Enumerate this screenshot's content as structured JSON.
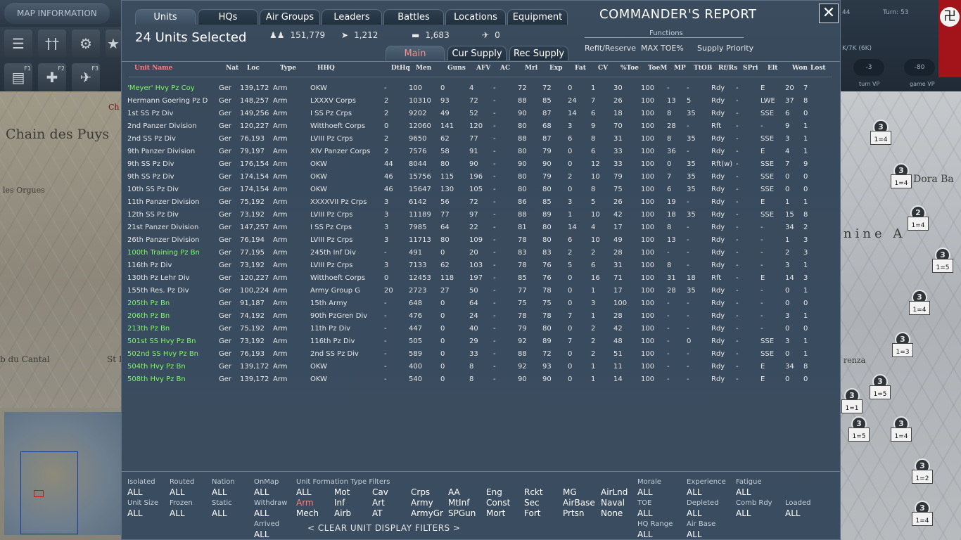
{
  "map": {
    "info_button": "MAP INFORMATION",
    "labels": [
      "Chain des Puys",
      "les Orgues",
      "b du Cantal",
      "St I",
      "Dora Ba",
      "nine A",
      "renza",
      "Ch"
    ],
    "status": {
      "left_value": "44",
      "turn": "Turn: 53",
      "supply": "K/7K (6K)",
      "pill_a": "-3",
      "pill_b": "-80",
      "turn_vp": "turn VP",
      "game_vp": "game VP"
    },
    "counters": [
      {
        "top": "3",
        "bottom": "1=4"
      },
      {
        "top": "3",
        "bottom": "1=4"
      },
      {
        "top": "2",
        "bottom": "1=4"
      },
      {
        "top": "3",
        "bottom": "1=5"
      },
      {
        "top": "3",
        "bottom": "1=4"
      },
      {
        "top": "3",
        "bottom": "1=3"
      },
      {
        "top": "3",
        "bottom": "1=5"
      },
      {
        "top": "3",
        "bottom": "1=5"
      },
      {
        "top": "3",
        "bottom": "1=4"
      },
      {
        "top": "3",
        "bottom": "1=2"
      },
      {
        "top": "3",
        "bottom": "1=4"
      },
      {
        "top": "3",
        "bottom": "1=1"
      },
      {
        "top": "3",
        "bottom": "1=5"
      }
    ],
    "toolbar_keys": [
      "F1",
      "F2",
      "F3"
    ]
  },
  "dialog": {
    "title": "COMMANDER'S REPORT",
    "tabs": [
      "Units",
      "HQs",
      "Air Groups",
      "Leaders",
      "Battles",
      "Locations",
      "Equipment"
    ],
    "active_tab": "Units",
    "units_selected": "24 Units Selected",
    "stats": {
      "men": "151,779",
      "guns": "1,212",
      "afv": "1,683",
      "aircraft": "0"
    },
    "functions": {
      "label": "Functions",
      "refit": "Refit/Reserve",
      "max_toe": "MAX TOE%",
      "supply": "Supply Priority"
    },
    "subtabs": [
      "Main",
      "Cur Supply",
      "Rec Supply"
    ],
    "active_subtab": "Main",
    "columns": [
      "Unit Name",
      "Nat",
      "Loc",
      "Type",
      "HHQ",
      "DtHq",
      "Men",
      "Guns",
      "AFV",
      "AC",
      "Mrl",
      "Exp",
      "Fat",
      "CV",
      "%Toe",
      "ToeM",
      "MP",
      "TtOB",
      "Rf/Rs",
      "SPri",
      "Elt",
      "Won",
      "Lost"
    ],
    "rows": [
      {
        "name": "'Meyer' Hvy Pz Coy",
        "green": true,
        "v": [
          "Ger",
          "139,172",
          "Arm",
          "OKW",
          "-",
          "100",
          "0",
          "4",
          "-",
          "72",
          "72",
          "0",
          "1",
          "30",
          "100",
          "-",
          "-",
          "Rdy",
          "-",
          "E",
          "20",
          "7"
        ]
      },
      {
        "name": "Hermann Goering Pz D",
        "green": false,
        "v": [
          "Ger",
          "148,257",
          "Arm",
          "LXXXV Corps",
          "2",
          "10310",
          "93",
          "72",
          "-",
          "88",
          "85",
          "24",
          "7",
          "26",
          "100",
          "13",
          "5",
          "Rdy",
          "-",
          "LWE",
          "37",
          "8"
        ]
      },
      {
        "name": "1st SS Pz Div",
        "green": false,
        "v": [
          "Ger",
          "149,256",
          "Arm",
          "I SS Pz Crps",
          "2",
          "9202",
          "49",
          "52",
          "-",
          "90",
          "87",
          "14",
          "6",
          "18",
          "100",
          "8",
          "35",
          "Rdy",
          "-",
          "SSE",
          "6",
          "0"
        ]
      },
      {
        "name": "2nd Panzer Division",
        "green": false,
        "v": [
          "Ger",
          "120,227",
          "Arm",
          "Witthoeft Corps",
          "0",
          "12060",
          "141",
          "120",
          "-",
          "80",
          "68",
          "3",
          "9",
          "70",
          "100",
          "28",
          "-",
          "Rft",
          "-",
          "-",
          "9",
          "1"
        ]
      },
      {
        "name": "2nd SS Pz Div",
        "green": false,
        "v": [
          "Ger",
          "76,193",
          "Arm",
          "LVIII Pz Crps",
          "2",
          "9650",
          "62",
          "77",
          "-",
          "88",
          "87",
          "6",
          "8",
          "31",
          "100",
          "8",
          "35",
          "Rdy",
          "-",
          "SSE",
          "3",
          "1"
        ]
      },
      {
        "name": "9th Panzer Division",
        "green": false,
        "v": [
          "Ger",
          "79,197",
          "Arm",
          "XIV Panzer Corps",
          "2",
          "7576",
          "58",
          "91",
          "-",
          "80",
          "79",
          "0",
          "6",
          "33",
          "100",
          "36",
          "-",
          "Rdy",
          "-",
          "E",
          "4",
          "1"
        ]
      },
      {
        "name": "9th SS Pz Div",
        "green": false,
        "v": [
          "Ger",
          "176,154",
          "Arm",
          "OKW",
          "44",
          "8044",
          "80",
          "90",
          "-",
          "90",
          "90",
          "0",
          "12",
          "33",
          "100",
          "0",
          "35",
          "Rft(w)",
          "-",
          "SSE",
          "7",
          "9"
        ]
      },
      {
        "name": "9th SS Pz Div",
        "green": false,
        "v": [
          "Ger",
          "174,154",
          "Arm",
          "OKW",
          "46",
          "15756",
          "115",
          "196",
          "-",
          "80",
          "79",
          "2",
          "10",
          "79",
          "100",
          "7",
          "35",
          "Rdy",
          "-",
          "SSE",
          "0",
          "0"
        ]
      },
      {
        "name": "10th SS Pz Div",
        "green": false,
        "v": [
          "Ger",
          "174,154",
          "Arm",
          "OKW",
          "46",
          "15647",
          "130",
          "105",
          "-",
          "80",
          "80",
          "0",
          "8",
          "75",
          "100",
          "6",
          "35",
          "Rdy",
          "-",
          "SSE",
          "0",
          "0"
        ]
      },
      {
        "name": "11th Panzer Division",
        "green": false,
        "v": [
          "Ger",
          "75,192",
          "Arm",
          "XXXXVII Pz Crps",
          "3",
          "6142",
          "56",
          "72",
          "-",
          "86",
          "85",
          "3",
          "5",
          "26",
          "100",
          "19",
          "-",
          "Rdy",
          "-",
          "E",
          "1",
          "1"
        ]
      },
      {
        "name": "12th SS Pz Div",
        "green": false,
        "v": [
          "Ger",
          "73,192",
          "Arm",
          "LVIII Pz Crps",
          "3",
          "11189",
          "77",
          "97",
          "-",
          "88",
          "89",
          "1",
          "10",
          "42",
          "100",
          "18",
          "35",
          "Rdy",
          "-",
          "SSE",
          "15",
          "8"
        ]
      },
      {
        "name": "21st Panzer Division",
        "green": false,
        "v": [
          "Ger",
          "147,257",
          "Arm",
          "I SS Pz Crps",
          "3",
          "7985",
          "64",
          "22",
          "-",
          "81",
          "80",
          "14",
          "4",
          "17",
          "100",
          "8",
          "-",
          "Rdy",
          "-",
          "-",
          "34",
          "2"
        ]
      },
      {
        "name": "26th Panzer Division",
        "green": false,
        "v": [
          "Ger",
          "76,194",
          "Arm",
          "LVIII Pz Crps",
          "3",
          "11713",
          "80",
          "109",
          "-",
          "78",
          "80",
          "6",
          "10",
          "49",
          "100",
          "13",
          "-",
          "Rdy",
          "-",
          "-",
          "1",
          "3"
        ]
      },
      {
        "name": "100th Training Pz Bn",
        "green": true,
        "v": [
          "Ger",
          "77,195",
          "Arm",
          "245th Inf Div",
          "-",
          "491",
          "0",
          "20",
          "-",
          "83",
          "83",
          "2",
          "2",
          "28",
          "100",
          "-",
          "-",
          "Rdy",
          "-",
          "-",
          "2",
          "3"
        ]
      },
      {
        "name": "116th Pz Div",
        "green": false,
        "v": [
          "Ger",
          "73,192",
          "Arm",
          "LVIII Pz Crps",
          "3",
          "7133",
          "62",
          "103",
          "-",
          "78",
          "76",
          "5",
          "6",
          "31",
          "100",
          "8",
          "-",
          "Rdy",
          "-",
          "-",
          "3",
          "1"
        ]
      },
      {
        "name": "130th Pz Lehr Div",
        "green": false,
        "v": [
          "Ger",
          "120,227",
          "Arm",
          "Witthoeft Corps",
          "0",
          "12453",
          "118",
          "197",
          "-",
          "85",
          "76",
          "0",
          "16",
          "71",
          "100",
          "31",
          "18",
          "Rft",
          "-",
          "E",
          "14",
          "3"
        ]
      },
      {
        "name": "155th Res. Pz Div",
        "green": false,
        "v": [
          "Ger",
          "100,224",
          "Arm",
          "Army Group G",
          "20",
          "2723",
          "27",
          "50",
          "-",
          "77",
          "78",
          "0",
          "1",
          "17",
          "100",
          "28",
          "35",
          "Rdy",
          "-",
          "-",
          "0",
          "1"
        ]
      },
      {
        "name": "205th Pz Bn",
        "green": true,
        "v": [
          "Ger",
          "91,187",
          "Arm",
          "15th Army",
          "-",
          "648",
          "0",
          "64",
          "-",
          "75",
          "75",
          "0",
          "3",
          "100",
          "100",
          "-",
          "-",
          "Rdy",
          "-",
          "-",
          "0",
          "0"
        ]
      },
      {
        "name": "206th Pz Bn",
        "green": true,
        "v": [
          "Ger",
          "74,192",
          "Arm",
          "90th PzGren Div",
          "-",
          "476",
          "0",
          "24",
          "-",
          "78",
          "78",
          "7",
          "1",
          "28",
          "100",
          "-",
          "-",
          "Rdy",
          "-",
          "-",
          "3",
          "1"
        ]
      },
      {
        "name": "213th Pz Bn",
        "green": true,
        "v": [
          "Ger",
          "75,192",
          "Arm",
          "11th Pz Div",
          "-",
          "447",
          "0",
          "40",
          "-",
          "79",
          "80",
          "0",
          "2",
          "42",
          "100",
          "-",
          "-",
          "Rdy",
          "-",
          "-",
          "0",
          "0"
        ]
      },
      {
        "name": "501st SS Hvy Pz Bn",
        "green": true,
        "v": [
          "Ger",
          "73,192",
          "Arm",
          "116th Pz Div",
          "-",
          "505",
          "0",
          "29",
          "-",
          "92",
          "89",
          "7",
          "2",
          "48",
          "100",
          "-",
          "0",
          "Rdy",
          "-",
          "SSE",
          "3",
          "1"
        ]
      },
      {
        "name": "502nd SS Hvy Pz Bn",
        "green": true,
        "v": [
          "Ger",
          "76,193",
          "Arm",
          "2nd SS Pz Div",
          "-",
          "589",
          "0",
          "33",
          "-",
          "88",
          "72",
          "0",
          "2",
          "51",
          "100",
          "-",
          "-",
          "Rdy",
          "-",
          "SSE",
          "0",
          "1"
        ]
      },
      {
        "name": "504th Hvy Pz Bn",
        "green": true,
        "v": [
          "Ger",
          "139,172",
          "Arm",
          "OKW",
          "-",
          "400",
          "0",
          "8",
          "-",
          "92",
          "93",
          "0",
          "1",
          "11",
          "100",
          "-",
          "-",
          "Rdy",
          "-",
          "E",
          "34",
          "8"
        ]
      },
      {
        "name": "508th Hvy Pz Bn",
        "green": true,
        "v": [
          "Ger",
          "139,172",
          "Arm",
          "OKW",
          "-",
          "540",
          "0",
          "8",
          "-",
          "90",
          "90",
          "0",
          "1",
          "14",
          "100",
          "-",
          "-",
          "Rdy",
          "-",
          "E",
          "0",
          "0"
        ]
      }
    ],
    "filters": {
      "isolated": {
        "label": "Isolated",
        "value": "ALL"
      },
      "routed": {
        "label": "Routed",
        "value": "ALL"
      },
      "nation": {
        "label": "Nation",
        "value": "ALL"
      },
      "onmap": {
        "label": "OnMap",
        "value": "ALL"
      },
      "unit_size": {
        "label": "Unit Size",
        "value": "ALL"
      },
      "frozen": {
        "label": "Frozen",
        "value": "ALL"
      },
      "static": {
        "label": "Static",
        "value": "ALL"
      },
      "withdraw": {
        "label": "Withdraw",
        "value": "ALL"
      },
      "arrived": {
        "label": "Arrived",
        "value": "ALL"
      },
      "formation_label": "Unit  Formation  Type  Filters",
      "formation_grid": [
        [
          "ALL",
          "Mot",
          "Cav",
          "Crps",
          "AA",
          "Eng",
          "Rckt",
          "MG",
          "AirLnd"
        ],
        [
          "Arm",
          "Inf",
          "Art",
          "Army",
          "MtInf",
          "Const",
          "Sec",
          "AirBase",
          "Naval"
        ],
        [
          "Mech",
          "Airb",
          "AT",
          "ArmyGr",
          "SPGun",
          "Mort",
          "Fort",
          "Prtsn",
          "None"
        ]
      ],
      "morale": {
        "label": "Morale",
        "value": "ALL"
      },
      "toe": {
        "label": "TOE",
        "value": "ALL"
      },
      "hq_range": {
        "label": "HQ Range",
        "value": "ALL"
      },
      "experience": {
        "label": "Experience",
        "value": "ALL"
      },
      "depleted": {
        "label": "Depleted",
        "value": "ALL"
      },
      "air_base": {
        "label": "Air Base",
        "value": "ALL"
      },
      "fatigue": {
        "label": "Fatigue",
        "value": "ALL"
      },
      "comb_rdy": {
        "label": "Comb Rdy",
        "value": "ALL"
      },
      "loaded": {
        "label": "Loaded",
        "value": "ALL"
      },
      "clear": "< CLEAR UNIT DISPLAY FILTERS >"
    }
  },
  "colors": {
    "accent_red": "#ff7f7f",
    "green_unit": "#7cfc5c",
    "panel": "#384a5c"
  }
}
